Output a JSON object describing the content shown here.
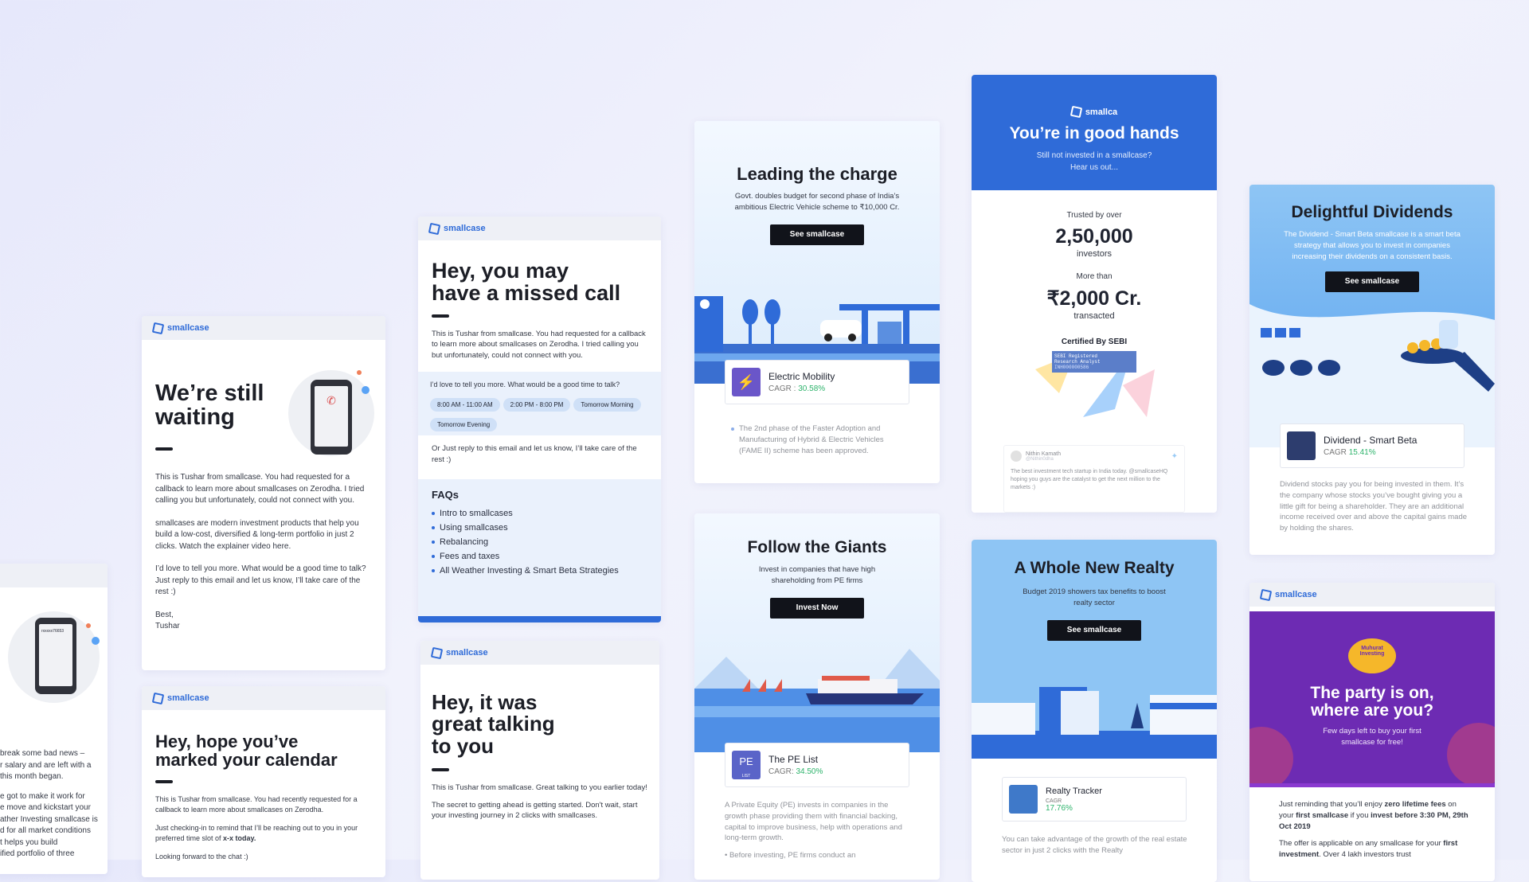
{
  "brand": "smallcase",
  "c1": {
    "lines": [
      "break some bad news –",
      "r salary and are left with a",
      "this month began.",
      "e got to make it work for",
      "e move and kickstart your",
      "ather Investing smallcase is",
      "d for all market conditions",
      "t helps you build",
      "ified portfolio of three"
    ],
    "phone_text": "rxxxxx76653"
  },
  "c2": {
    "title_l1": "We’re still",
    "title_l2": "waiting",
    "p1": "This is Tushar from smallcase. You had requested for a callback to learn more about smallcases on Zerodha. I tried calling you but unfortunately, could not connect with you.",
    "p2": "smallcases are modern investment products that help you build a low-cost, diversified & long-term portfolio in just 2 clicks. Watch the explainer video here.",
    "p3": "I’d love to tell you more. What would be a good time to talk? Just reply to this email and let us know, I’ll take care of the rest :)",
    "sign1": "Best,",
    "sign2": "Tushar"
  },
  "c3": {
    "title_l1": "Hey, hope you’ve",
    "title_l2": "marked your calendar",
    "p1": "This is Tushar from smallcase. You had recently requested for a callback to learn more about smallcases on Zerodha.",
    "p2a": "Just checking-in to remind that I’ll be reaching out to you in your preferred time slot of ",
    "p2b": "x-x today.",
    "p3": "Looking forward to the chat :)"
  },
  "c4": {
    "title_l1": "Hey, you may",
    "title_l2": "have a missed call",
    "p1": "This is Tushar from smallcase. You had requested for a callback to learn more about smallcases on Zerodha. I tried calling you but unfortunately, could not connect with you.",
    "ask": "I’d love to tell you more. What would be a good time to talk?",
    "slots": [
      "8:00 AM - 11:00 AM",
      "2:00 PM - 8:00 PM",
      "Tomorrow Morning",
      "Tomorrow Evening"
    ],
    "p2": "Or Just reply to this email and let us know, I’ll take care of the rest :)",
    "faq_title": "FAQs",
    "faqs": [
      "Intro to smallcases",
      "Using smallcases",
      "Rebalancing",
      "Fees and taxes",
      "All Weather Investing & Smart Beta Strategies"
    ]
  },
  "c5": {
    "title_l1": "Hey, it was",
    "title_l2": "great talking",
    "title_l3": "to you",
    "p1": "This is Tushar from smallcase. Great talking to you earlier today!",
    "p2": "The secret to getting ahead is getting started. Don't wait, start your investing journey in 2 clicks with smallcases."
  },
  "c6": {
    "title": "Leading the charge",
    "sub": "Govt. doubles budget for second phase of India’s ambitious Electric Vehicle scheme to ₹10,000 Cr.",
    "btn": "See smallcase",
    "prod_name": "Electric Mobility",
    "cagr_label": "CAGR :",
    "cagr": "30.58%",
    "body": "The 2nd phase of the Faster Adoption and Manufacturing of Hybrid & Electric Vehicles (FAME II) scheme has been approved."
  },
  "c7": {
    "title": "Follow the Giants",
    "sub": "Invest in companies that have high shareholding from PE firms",
    "btn": "Invest Now",
    "prod_name": "The PE List",
    "thumb": "PE",
    "thumb_sub": "LIST",
    "cagr_label": "CAGR:",
    "cagr": "34.50%",
    "body": "A Private Equity (PE) invests in companies in the growth phase providing them with financial backing, capital to improve business, help with operations and long-term growth.",
    "b1": "Before investing, PE firms conduct an"
  },
  "c8": {
    "logo": "smallca",
    "title": "You’re in good hands",
    "sub_l1": "Still not invested in a smallcase?",
    "sub_l2": "Hear us out...",
    "trusted": "Trusted by over",
    "investors_num": "2,50,000",
    "investors": "investors",
    "more": "More than",
    "amount": "₹2,000 Cr.",
    "transacted": "transacted",
    "cert": "Certified By SEBI",
    "sebi1": "SEBI Registered",
    "sebi2": "Research Analyst",
    "sebi3": "INH000000586",
    "tw_name": "Nithin Kamath",
    "tw_handle": "@Nithin0dha",
    "tw_text": "The best investment tech startup in India today. @smallcaseHQ hoping you guys are the catalyst to get the next million to the markets :)"
  },
  "c9": {
    "title": "A Whole New Realty",
    "sub": "Budget 2019 showers tax benefits to boost realty sector",
    "btn": "See smallcase",
    "prod_name": "Realty Tracker",
    "cagr_label": "CAGR",
    "cagr": "17.76%",
    "body": "You can take advantage of the growth of the real estate sector in just 2 clicks with the Realty"
  },
  "c10": {
    "title": "Delightful Dividends",
    "sub": "The Dividend - Smart Beta smallcase is a smart beta strategy that allows you to invest in companies increasing their dividends on a consistent basis.",
    "btn": "See smallcase",
    "prod_name": "Dividend - Smart Beta",
    "cagr_label": "CAGR",
    "cagr": "15.41%",
    "body": "Dividend stocks pay you for being invested in them. It’s the company whose stocks you’ve bought giving you a little gift for being a shareholder. They are an additional income received over and above the capital gains made by holding the shares."
  },
  "c11": {
    "badge_l1": "Muhurat",
    "badge_l2": "Investing",
    "title_l1": "The party is on,",
    "title_l2": "where are you?",
    "sub": "Few days left to buy your first smallcase for free!",
    "p1a": "Just reminding that you’ll enjoy ",
    "p1b": "zero lifetime fees",
    "p1c": " on your ",
    "p1d": "first smallcase",
    "p1e": " if you ",
    "p1f": "invest before 3:30 PM, 29th Oct 2019",
    "p2a": "The offer is applicable on any smallcase for your ",
    "p2b": "first investment",
    "p2c": ". Over 4 lakh investors trust"
  },
  "colors": {
    "accent": "#2f6bd8",
    "cta": "#11131a",
    "green": "#2db36b",
    "purple": "#6d2bb3",
    "sky": "#8ec5f4"
  },
  "icons": [
    "logo-icon",
    "phone-icon",
    "twitter-icon",
    "bolt-icon",
    "sebi-icon"
  ]
}
